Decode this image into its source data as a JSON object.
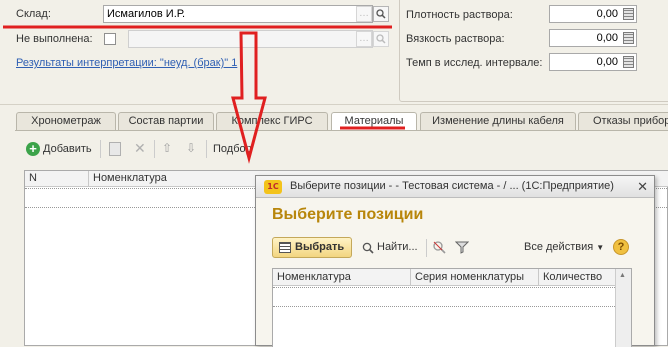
{
  "form": {
    "sklad_label": "Склад:",
    "sklad_value": "Исмагилов И.Р.",
    "ne_vypolnena_label": "Не выполнена:",
    "interpret_link": "Результаты интерпретации: \"неуд. (брак)\" 1"
  },
  "right_fields": [
    {
      "label": "Плотность раствора:",
      "value": "0,00"
    },
    {
      "label": "Вязкость раствора:",
      "value": "0,00"
    },
    {
      "label": "Темп в исслед. интервале:",
      "value": "0,00"
    }
  ],
  "tabs": [
    {
      "label": "Хронометраж"
    },
    {
      "label": "Состав партии"
    },
    {
      "label": "Комплекс ГИРС"
    },
    {
      "label": "Материалы"
    },
    {
      "label": "Изменение длины кабеля"
    },
    {
      "label": "Отказы приборов"
    }
  ],
  "toolbar": {
    "add_label": "Добавить",
    "podbor_label": "Подбор"
  },
  "table": {
    "columns": [
      "N",
      "Номенклатура"
    ]
  },
  "dialog": {
    "title": "Выберите позиции - - Тестовая система - / ...  (1С:Предприятие)",
    "logo": "1С",
    "heading": "Выберите позиции",
    "choose_label": "Выбрать",
    "find_label": "Найти...",
    "all_actions_label": "Все действия",
    "help_label": "?",
    "columns": [
      "Номенклатура",
      "Серия номенклатуры",
      "Количество"
    ]
  },
  "colors": {
    "annotation_red": "#e02020",
    "link_blue": "#2f5fb3",
    "dialog_heading": "#b8860b"
  }
}
